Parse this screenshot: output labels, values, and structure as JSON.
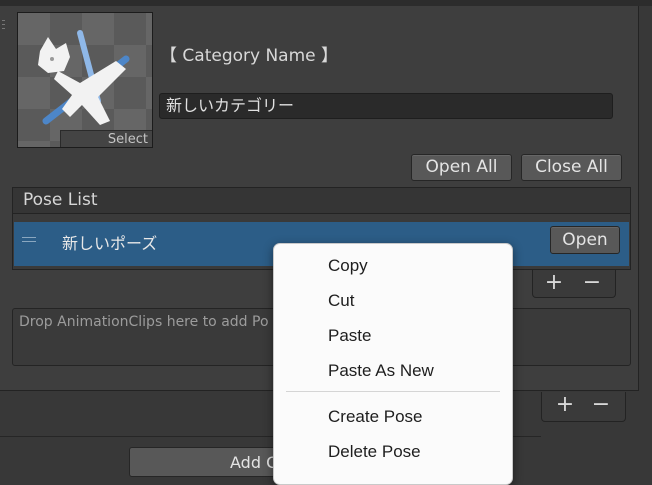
{
  "category": {
    "label": "【 Category Name 】",
    "name_value": "新しいカテゴリー",
    "thumbnail_select_label": "Select",
    "icon": "pose-cat-icon"
  },
  "toolbar": {
    "open_all_label": "Open All",
    "close_all_label": "Close All"
  },
  "pose_list": {
    "header": "Pose List",
    "items": [
      {
        "label": "新しいポーズ",
        "open_label": "Open"
      }
    ],
    "add_label": "+",
    "remove_label": "−"
  },
  "drop_area": {
    "text": "Drop AnimationClips here to add Po"
  },
  "category_list": {
    "add_label": "+",
    "remove_label": "−"
  },
  "bottom_button": {
    "label": "Add C"
  },
  "context_menu": {
    "items": [
      {
        "label": "Copy"
      },
      {
        "label": "Cut"
      },
      {
        "label": "Paste"
      },
      {
        "label": "Paste As New"
      },
      {
        "label": "Create Pose"
      },
      {
        "label": "Delete Pose"
      }
    ]
  },
  "colors": {
    "selected_row": "#2c5d87",
    "panel": "#3e3e3e",
    "menu_bg": "#fbfbfb"
  }
}
